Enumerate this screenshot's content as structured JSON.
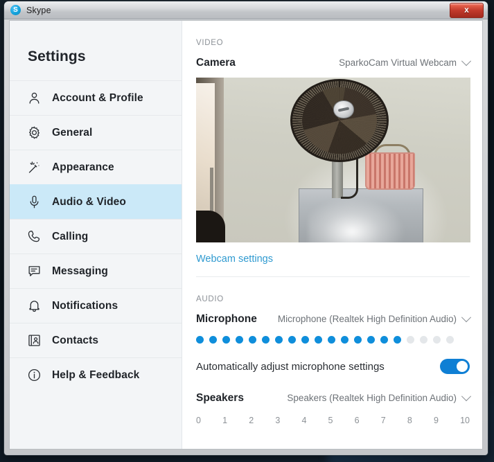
{
  "window": {
    "title": "Skype",
    "logo_letter": "S",
    "close_label": "x"
  },
  "sidebar": {
    "title": "Settings",
    "items": [
      {
        "label": "Account & Profile",
        "icon": "person-icon",
        "active": false
      },
      {
        "label": "General",
        "icon": "gear-icon",
        "active": false
      },
      {
        "label": "Appearance",
        "icon": "wand-icon",
        "active": false
      },
      {
        "label": "Audio & Video",
        "icon": "microphone-icon",
        "active": true
      },
      {
        "label": "Calling",
        "icon": "phone-icon",
        "active": false
      },
      {
        "label": "Messaging",
        "icon": "chat-icon",
        "active": false
      },
      {
        "label": "Notifications",
        "icon": "bell-icon",
        "active": false
      },
      {
        "label": "Contacts",
        "icon": "contact-card-icon",
        "active": false
      },
      {
        "label": "Help & Feedback",
        "icon": "info-icon",
        "active": false
      }
    ]
  },
  "content": {
    "video_section_label": "VIDEO",
    "camera_label": "Camera",
    "camera_value": "SparkoCam Virtual Webcam",
    "webcam_settings_link": "Webcam settings",
    "audio_section_label": "AUDIO",
    "microphone_label": "Microphone",
    "microphone_value": "Microphone (Realtek High Definition Audio)",
    "mic_level": {
      "total_dots": 20,
      "active_dots": 16
    },
    "auto_adjust_label": "Automatically adjust microphone settings",
    "auto_adjust_on": true,
    "speakers_label": "Speakers",
    "speakers_value": "Speakers (Realtek High Definition Audio)",
    "speaker_scale": [
      "0",
      "1",
      "2",
      "3",
      "4",
      "5",
      "6",
      "7",
      "8",
      "9",
      "10"
    ]
  },
  "colors": {
    "accent_blue": "#0f8edb",
    "link_blue": "#2f9ad0",
    "active_nav_bg": "#cbe9f8",
    "toggle_on": "#0f7fd4",
    "dot_off": "#e4e7ea"
  }
}
